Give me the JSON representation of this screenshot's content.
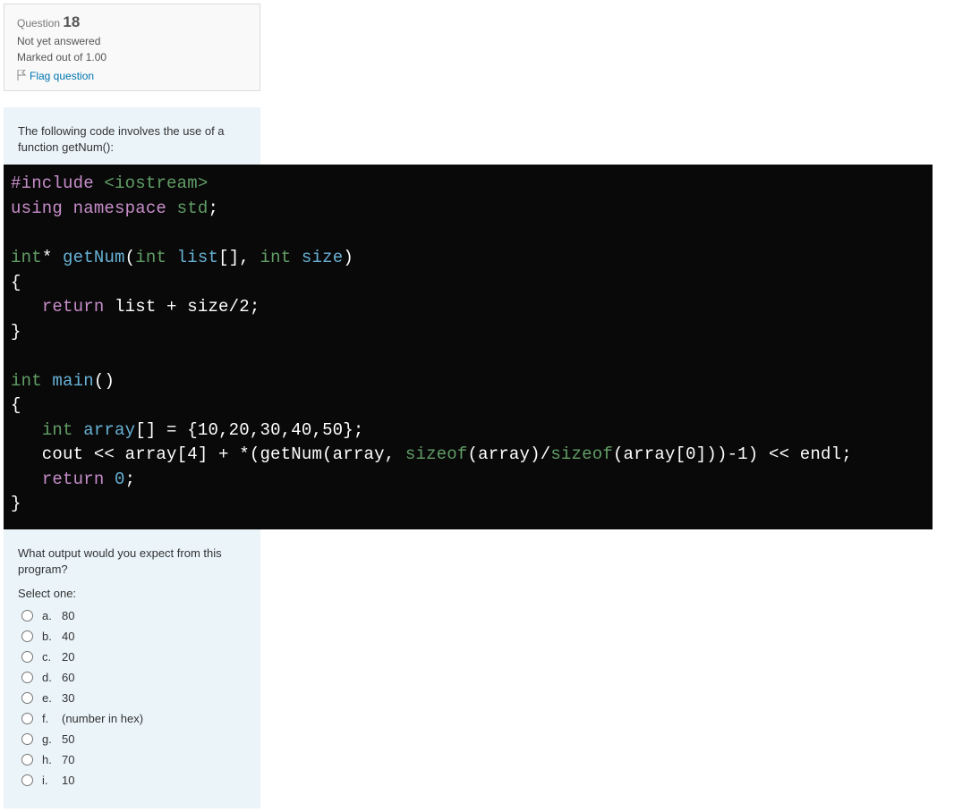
{
  "info": {
    "questionLabel": "Question",
    "questionNumber": "18",
    "status": "Not yet answered",
    "marked": "Marked out of 1.00",
    "flagText": "Flag question"
  },
  "question": {
    "intro": "The following code involves the use of a function getNum():",
    "afterCode": "What output would you expect from this program?",
    "selectPrompt": "Select one:"
  },
  "code": {
    "l1a": "#include",
    "l1b": " <iostream>",
    "l2a": "using",
    "l2b": " namespace",
    "l2c": " std",
    "l2d": ";",
    "l4a": "int",
    "l4b": "* ",
    "l4c": "getNum",
    "l4d": "(",
    "l4e": "int",
    "l4f": " list",
    "l4g": "[], ",
    "l4h": "int",
    "l4i": " size",
    "l4j": ")",
    "l5": "{",
    "l6a": "   ",
    "l6b": "return",
    "l6c": " list + size/2;",
    "l7": "}",
    "l9a": "int",
    "l9b": " ",
    "l9c": "main",
    "l9d": "()",
    "l10": "{",
    "l11a": "   ",
    "l11b": "int",
    "l11c": " array",
    "l11d": "[] = {10,20,30,40,50};",
    "l12a": "   cout << array[4] + *(getNum(array, ",
    "l12b": "sizeof",
    "l12c": "(array)/",
    "l12d": "sizeof",
    "l12e": "(array[0]))-1) << endl;",
    "l13a": "   ",
    "l13b": "return",
    "l13c": " ",
    "l13d": "0",
    "l13e": ";",
    "l14": "}"
  },
  "options": [
    {
      "letter": "a.",
      "text": "80"
    },
    {
      "letter": "b.",
      "text": "40"
    },
    {
      "letter": "c.",
      "text": "20"
    },
    {
      "letter": "d.",
      "text": "60"
    },
    {
      "letter": "e.",
      "text": "30"
    },
    {
      "letter": "f.",
      "text": "(number in hex)"
    },
    {
      "letter": "g.",
      "text": "50"
    },
    {
      "letter": "h.",
      "text": "70"
    },
    {
      "letter": "i.",
      "text": "10"
    }
  ]
}
